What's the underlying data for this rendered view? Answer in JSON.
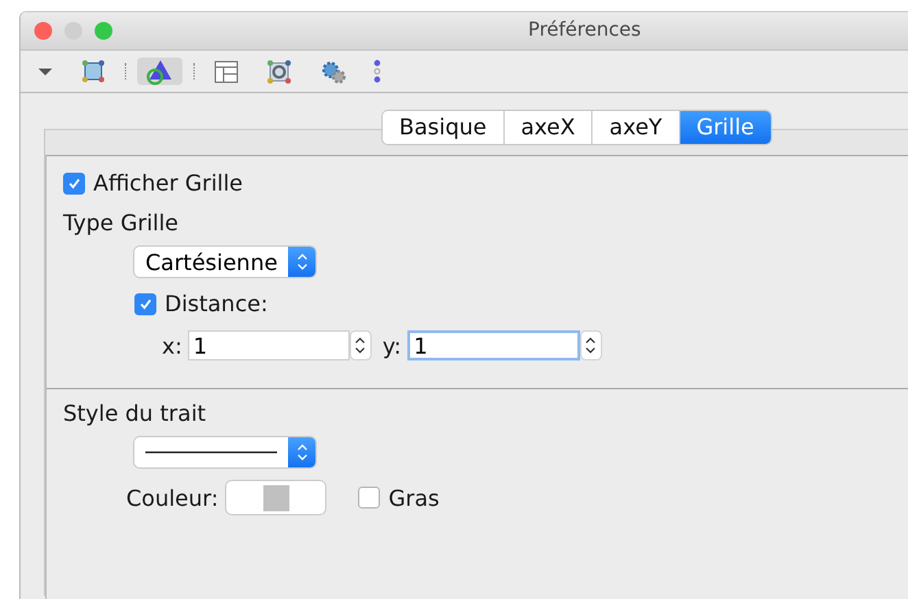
{
  "window": {
    "title": "Préférences"
  },
  "toolbar": [
    {
      "kind": "menu",
      "selected": false
    },
    {
      "kind": "square",
      "selected": false
    },
    {
      "kind": "triangle",
      "selected": true
    },
    {
      "kind": "layout",
      "selected": false
    },
    {
      "kind": "gear-square",
      "selected": false
    },
    {
      "kind": "gears",
      "selected": false
    },
    {
      "kind": "dots",
      "selected": false
    }
  ],
  "tabs": [
    {
      "label": "Basique",
      "selected": false
    },
    {
      "label": "axeX",
      "selected": false
    },
    {
      "label": "axeY",
      "selected": false
    },
    {
      "label": "Grille",
      "selected": true
    }
  ],
  "show_grid": {
    "label": "Afficher Grille",
    "checked": true
  },
  "grid_type": {
    "label": "Type Grille",
    "value": "Cartésienne"
  },
  "distance": {
    "label": "Distance:",
    "checked": true
  },
  "x_field": {
    "label": "x:",
    "value": "1",
    "focused": false
  },
  "y_field": {
    "label": "y:",
    "value": "1",
    "focused": true
  },
  "line_style": {
    "label": "Style du trait"
  },
  "color": {
    "label": "Couleur:",
    "color": "#c0c0c0"
  },
  "bold": {
    "label": "Gras",
    "checked": false
  }
}
